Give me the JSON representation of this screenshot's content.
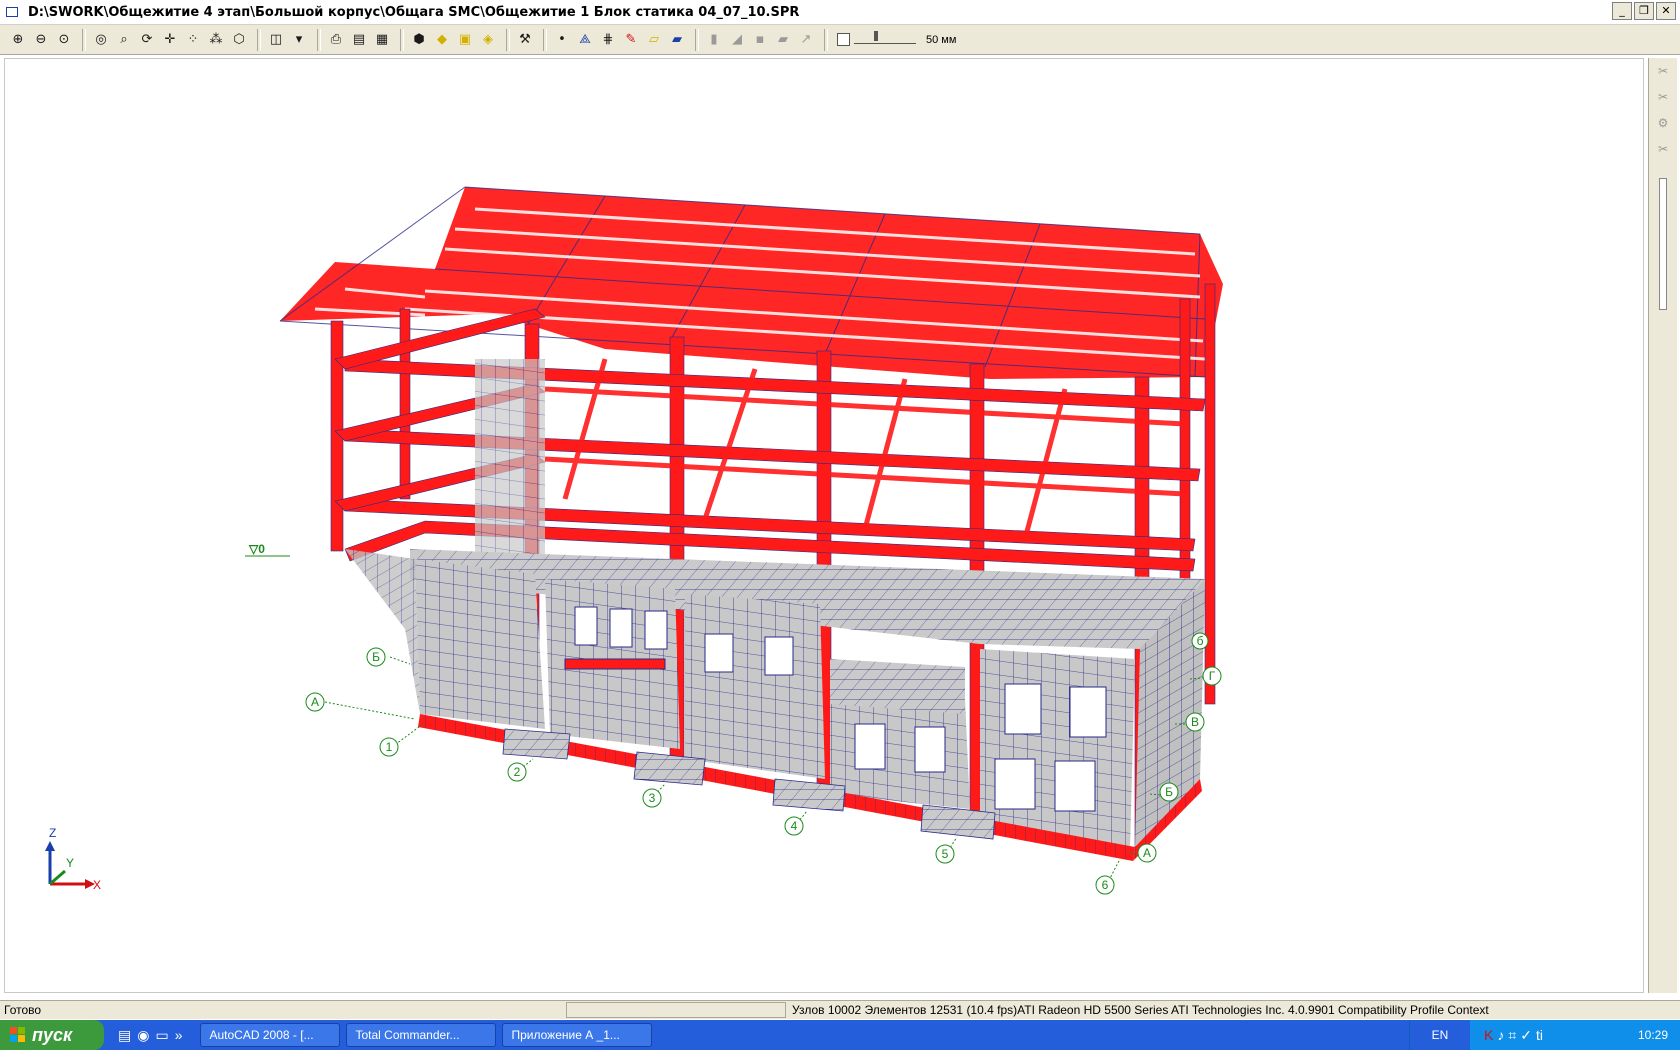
{
  "window": {
    "title": "D:\\SWORK\\Общежитие 4 этап\\Большой корпус\\Общага SMC\\Общежитие 1 Блок статика 04_07_10.SPR",
    "controls": [
      "minimize-icon",
      "restore-icon",
      "close-icon"
    ]
  },
  "toolbar": {
    "scale_label": "50 мм",
    "icons": [
      "zoom-in-icon",
      "zoom-out-icon",
      "zoom-window-icon",
      "zoom-prev-icon",
      "zoom-all-icon",
      "rotate-icon",
      "pan-icon",
      "select-node-icon",
      "select-element-icon",
      "select-filter-icon",
      "cube-view-icon",
      "projection-dropdown-icon",
      "print-icon",
      "print-preview-icon",
      "export-icon",
      "wireframe-icon",
      "shaded-icon",
      "render-icon",
      "solid-icon",
      "tools-icon",
      "point-icon",
      "node-icon",
      "grid-icon",
      "pencil-icon",
      "surface-icon",
      "plate-icon",
      "disabled-tool-icon-1",
      "disabled-tool-icon-2",
      "disabled-tool-icon-3",
      "disabled-tool-icon-4",
      "disabled-tool-icon-5"
    ]
  },
  "viewport": {
    "level_marker": "▽0",
    "axes": {
      "z": "Z",
      "y": "Y",
      "x": "X"
    },
    "grid_labels_numbers": [
      "1",
      "2",
      "3",
      "4",
      "5",
      "6"
    ],
    "grid_labels_letters_left": [
      "А",
      "Б"
    ],
    "grid_labels_letters_right": [
      "А",
      "Б",
      "В",
      "Г",
      "б"
    ],
    "colors": {
      "frame": "#ff1a1a",
      "mesh": "#1a1a80",
      "wall": "#c8c8c8",
      "annotation": "#1a8a1a"
    }
  },
  "statusbar": {
    "ready": "Готово",
    "info": "Узлов 10002  Элементов 12531  (10.4 fps)ATI Radeon HD 5500 Series ATI Technologies Inc. 4.0.9901 Compatibility Profile Context"
  },
  "taskbar": {
    "start": "пуск",
    "tasks": [
      "AutoCAD 2008 - [...",
      "Total Commander...",
      "Приложение А _1..."
    ],
    "language": "EN",
    "clock": "10:29"
  }
}
